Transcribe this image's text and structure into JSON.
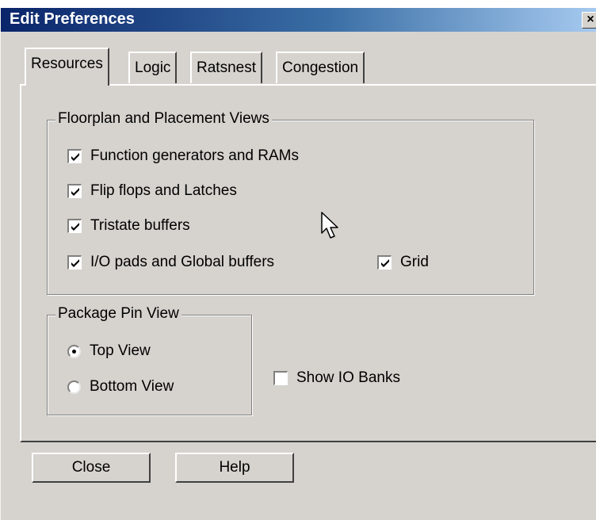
{
  "window": {
    "title": "Edit Preferences",
    "close_glyph": "×"
  },
  "tabs": [
    {
      "label": "Resources",
      "active": true
    },
    {
      "label": "Logic",
      "active": false
    },
    {
      "label": "Ratsnest",
      "active": false
    },
    {
      "label": "Congestion",
      "active": false
    }
  ],
  "floorplan": {
    "label": "Floorplan and Placement Views",
    "options": [
      {
        "label": "Function generators and RAMs",
        "checked": true
      },
      {
        "label": "Flip flops and Latches",
        "checked": true
      },
      {
        "label": "Tristate buffers",
        "checked": true
      },
      {
        "label": "I/O pads and Global buffers",
        "checked": true
      }
    ],
    "grid": {
      "label": "Grid",
      "checked": true
    }
  },
  "package_pin_view": {
    "label": "Package Pin View",
    "options": [
      {
        "label": "Top View",
        "selected": true
      },
      {
        "label": "Bottom View",
        "selected": false
      }
    ]
  },
  "show_io_banks": {
    "label": "Show IO Banks",
    "checked": false
  },
  "buttons": {
    "close": "Close",
    "help": "Help"
  },
  "icons": {
    "cursor": "arrow-cursor-icon",
    "check": "check-mark-icon"
  }
}
